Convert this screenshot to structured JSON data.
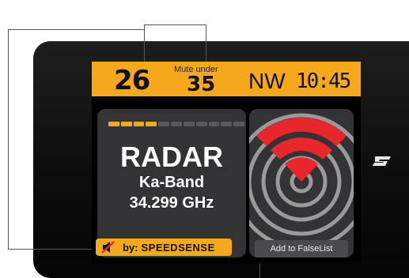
{
  "topbar": {
    "speed": "26",
    "mute_under_label": "Mute under",
    "mute_under_value": "35",
    "direction": "NW",
    "time": "10:45"
  },
  "alert": {
    "signal_strength": {
      "active": 4,
      "total": 11
    },
    "type": "RADAR",
    "band": "Ka-Band",
    "frequency": "34.299 GHz"
  },
  "muted": {
    "by_label": "by:",
    "source": "SPEEDSENSE",
    "icon": "speaker-muted-icon"
  },
  "radar_panel": {
    "icon": "radar-icon",
    "falselist_label": "Add to FalseList"
  },
  "colors": {
    "accent": "#f5a81c",
    "radar_red": "#e8262b",
    "panel": "#333335",
    "rings": "#9a9a9a"
  }
}
